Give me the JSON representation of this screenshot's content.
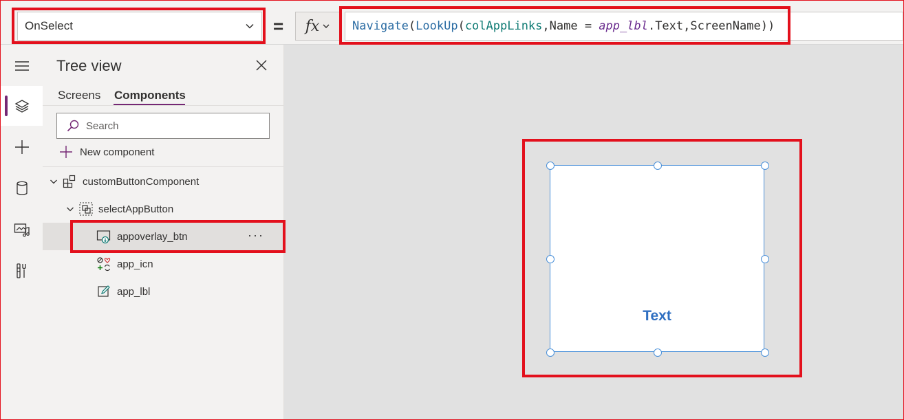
{
  "formula_bar": {
    "property": "OnSelect",
    "equals": "=",
    "fx_label": "fx",
    "formula_tokens": [
      {
        "text": "Navigate",
        "cls": "t-fn"
      },
      {
        "text": "(",
        "cls": "t-plain"
      },
      {
        "text": "LookUp",
        "cls": "t-fn"
      },
      {
        "text": "(",
        "cls": "t-plain"
      },
      {
        "text": "colAppLinks",
        "cls": "t-var"
      },
      {
        "text": ",Name = ",
        "cls": "t-plain"
      },
      {
        "text": "app_lbl",
        "cls": "t-ctrl"
      },
      {
        "text": ".Text,ScreenName))",
        "cls": "t-plain"
      }
    ]
  },
  "tree_view": {
    "title": "Tree view",
    "tabs": {
      "screens": "Screens",
      "components": "Components"
    },
    "search_placeholder": "Search",
    "new_component": "New component",
    "items": {
      "component": "customButtonComponent",
      "group": "selectAppButton",
      "button": "appoverlay_btn",
      "icon": "app_icn",
      "label": "app_lbl"
    },
    "more": "···"
  },
  "canvas": {
    "label_text": "Text"
  },
  "colors": {
    "accent": "#742774",
    "highlight": "#e3101c",
    "selection": "#4a90d9",
    "label_text": "#2f6fc1"
  }
}
